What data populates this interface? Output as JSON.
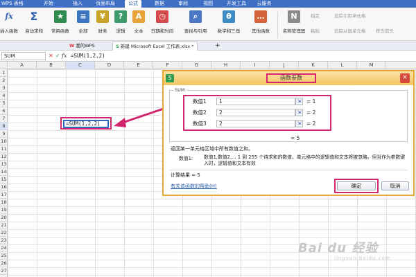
{
  "app": {
    "title": "WPS 表格"
  },
  "menubar": {
    "items": [
      "开始",
      "插入",
      "页面布局",
      "公式",
      "数据",
      "审阅",
      "视图",
      "开发工具",
      "云服务"
    ],
    "active": "公式"
  },
  "ribbon": {
    "buttons": [
      {
        "icon": "insert-function-icon",
        "label": "插入函数"
      },
      {
        "icon": "autosum-icon",
        "label": "自动求和"
      },
      {
        "icon": "common-function-icon",
        "label": "常用函数"
      },
      {
        "icon": "all-functions-icon",
        "label": "全部"
      },
      {
        "icon": "finance-icon",
        "label": "财务"
      },
      {
        "icon": "logic-icon",
        "label": "逻辑"
      },
      {
        "icon": "text-icon",
        "label": "文本"
      },
      {
        "icon": "date-time-icon",
        "label": "日期和时间"
      },
      {
        "icon": "lookup-icon",
        "label": "查找与引用"
      },
      {
        "icon": "math-icon",
        "label": "数学和三角"
      },
      {
        "icon": "other-functions-icon",
        "label": "其他函数"
      },
      {
        "icon": "name-manager-icon",
        "label": "名称管理器"
      }
    ],
    "small": [
      "指定",
      "粘贴",
      "追踪引用单元格",
      "追踪从属单元格",
      "移去箭头"
    ]
  },
  "tabs": {
    "items": [
      "我的WPS",
      "新建 Microsoft Excel 工作表.xlsx *"
    ],
    "add": "+"
  },
  "formulabar": {
    "namebox": "SUM",
    "fx": "fx",
    "formula": "=SUM(1,2,2)"
  },
  "grid": {
    "columns": [
      "A",
      "B",
      "C",
      "D",
      "E",
      "F",
      "G",
      "H",
      "I",
      "J",
      "K",
      "L",
      "M"
    ],
    "rows": [
      "1",
      "2",
      "3",
      "4",
      "5",
      "6",
      "7",
      "8",
      "9",
      "10",
      "11",
      "12",
      "13",
      "14",
      "15",
      "16",
      "17",
      "18",
      "19",
      "20",
      "21",
      "22",
      "23",
      "24",
      "25",
      "26",
      "27"
    ],
    "selected_column": "C",
    "selected_row": "8",
    "active_cell_text": "=SUM(1,2,2)"
  },
  "dialog": {
    "title": "函数参数",
    "group_label": "SUM",
    "args": [
      {
        "label": "数值1",
        "value": "1",
        "result": "= 1"
      },
      {
        "label": "数值2",
        "value": "2",
        "result": "= 2"
      },
      {
        "label": "数值3",
        "value": "2",
        "result": "= 2"
      }
    ],
    "total": "= 5",
    "description": "返回某一单元格区域中所有数值之和。",
    "arg_desc_label": "数值1:",
    "arg_desc_text": "数值1,数值2,... 1 到 255 个待求和的数值。单元格中的逻辑值和文本将被忽略。但当作为参数键入时，逻辑值和文本有效",
    "calc_result": "计算结果 = 5",
    "help_link": "有关该函数的帮助(H)",
    "ok": "确定",
    "cancel": "取消",
    "close": "×",
    "ref_glyph": "⇲"
  },
  "watermark": {
    "text": "Bai du 经验",
    "sub": "jingyan.baidu.com"
  },
  "colors": {
    "accent": "#3e6fc5",
    "highlight": "#d1266e",
    "dialog_border": "#e7a735"
  }
}
